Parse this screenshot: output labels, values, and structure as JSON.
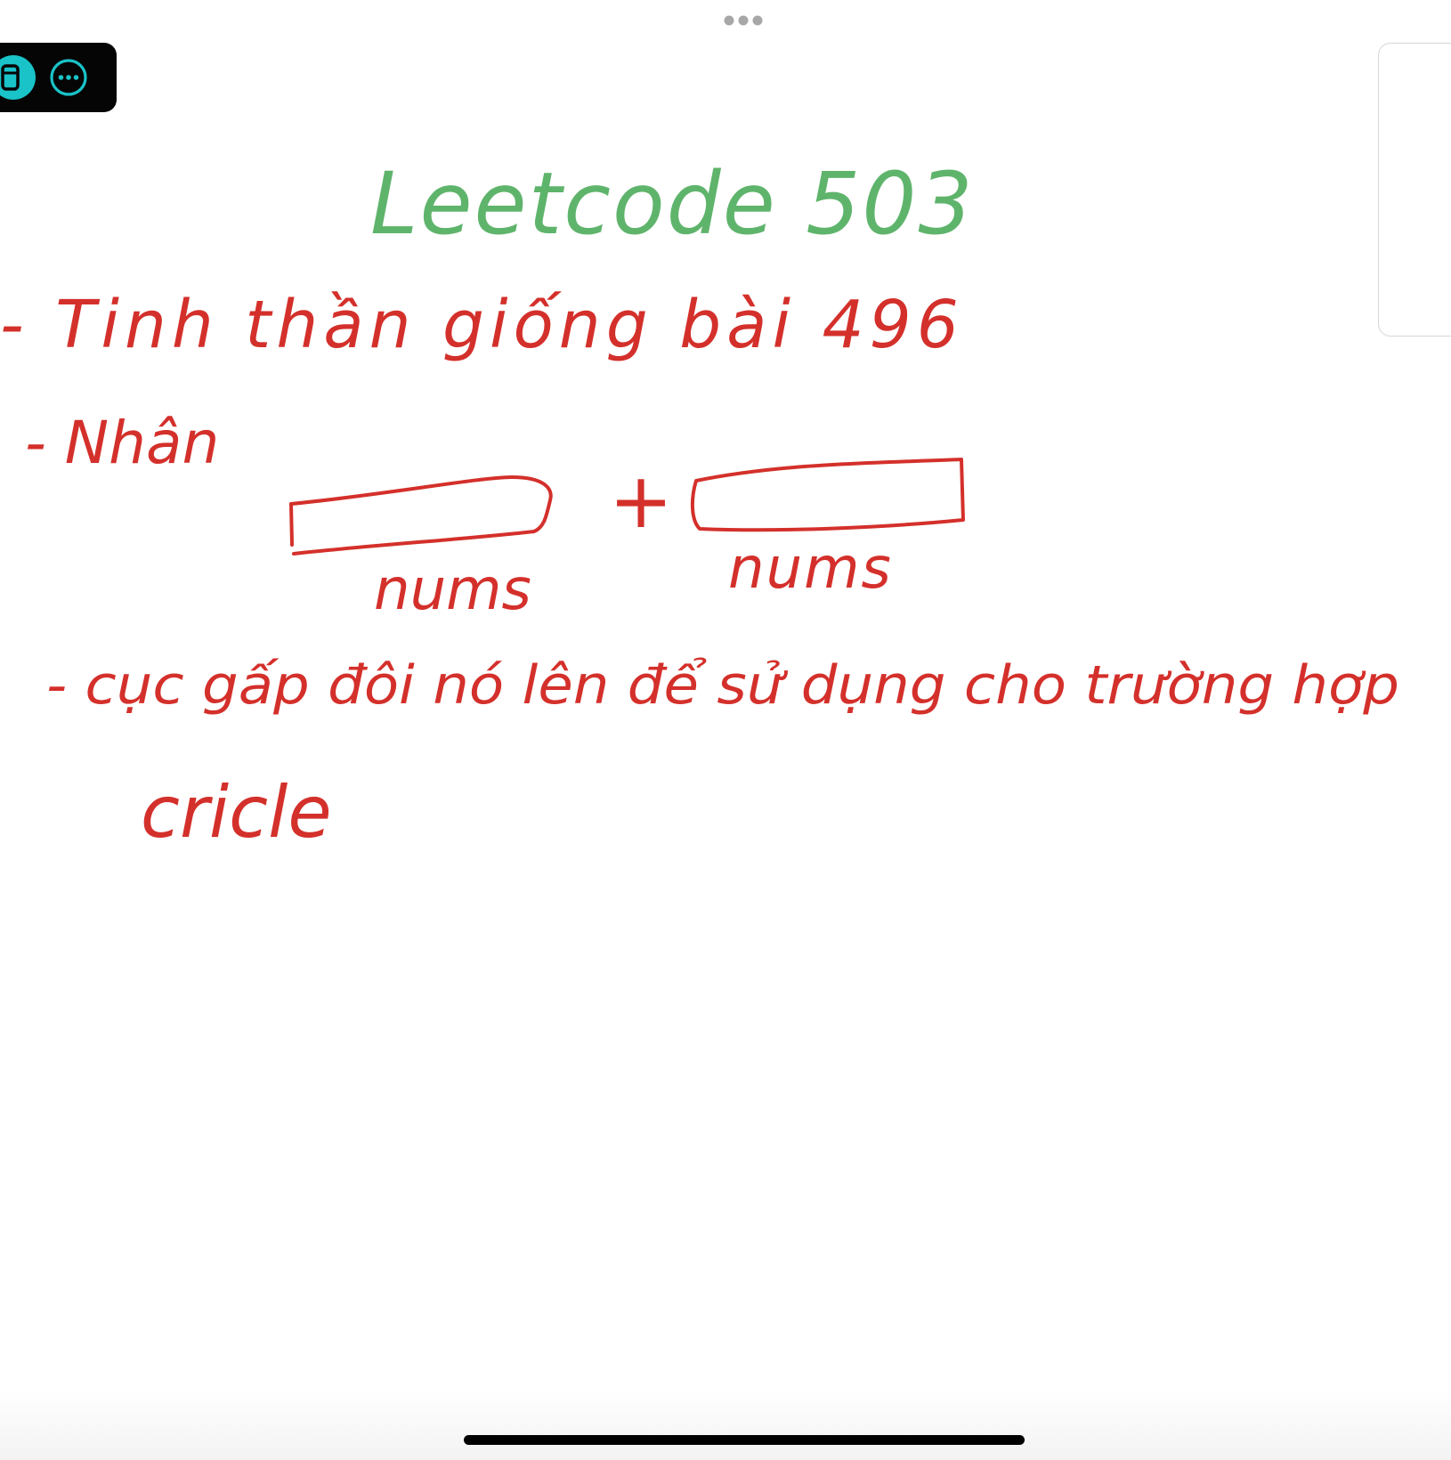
{
  "colors": {
    "title_ink": "#5fb46c",
    "body_ink": "#d4302b",
    "toolbar_bg": "#050505",
    "toolbar_icon": "#19c3c8",
    "handle": "#a7a7a7"
  },
  "toolbar": {
    "pen_icon": "pen-tool-icon",
    "more_icon": "more-options-icon"
  },
  "note": {
    "title": "Leetcode 503",
    "line_1": "- Tinh thần giống bài 496",
    "line_2": "- Nhân",
    "plus_sign": "+",
    "array_label_left": "nums",
    "array_label_right": "nums",
    "line_3": "- cục gấp đôi nó lên để sử dụng cho trường hợp",
    "line_4": "cricle"
  }
}
